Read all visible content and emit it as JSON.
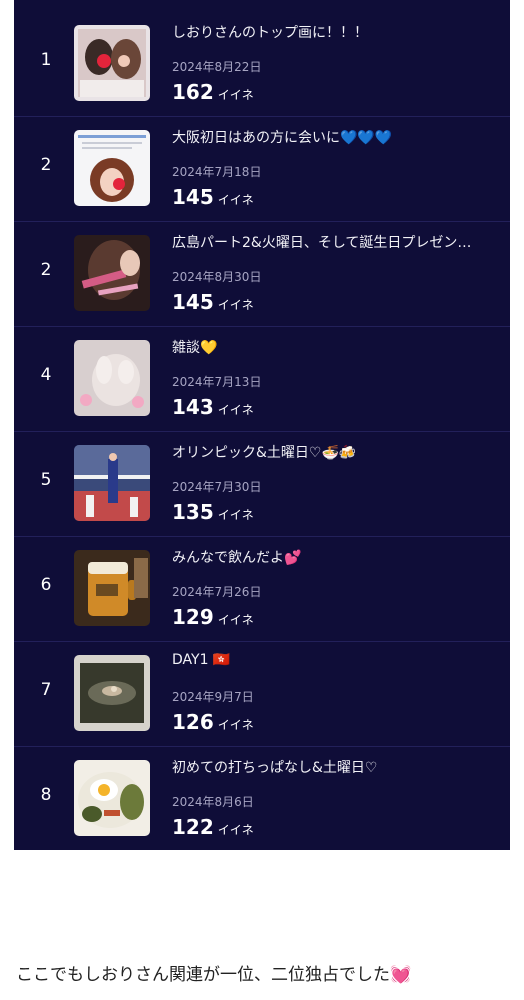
{
  "ranking": {
    "likes_unit": "イイネ",
    "items": [
      {
        "rank": "1",
        "title": "しおりさんのトップ画に！！！",
        "date": "2024年8月22日",
        "likes": "162"
      },
      {
        "rank": "2",
        "title": "大阪初日はあの方に会いに💙💙💙",
        "date": "2024年7月18日",
        "likes": "145"
      },
      {
        "rank": "2",
        "title": "広島パート2&火曜日、そして誕生日プレゼン…",
        "date": "2024年8月30日",
        "likes": "145"
      },
      {
        "rank": "4",
        "title": "雑談💛",
        "date": "2024年7月13日",
        "likes": "143"
      },
      {
        "rank": "5",
        "title": "オリンピック&土曜日♡🍜🍻",
        "date": "2024年7月30日",
        "likes": "135"
      },
      {
        "rank": "6",
        "title": "みんなで飲んだよ💕",
        "date": "2024年7月26日",
        "likes": "129"
      },
      {
        "rank": "7",
        "title": "DAY1 🇭🇰",
        "date": "2024年9月7日",
        "likes": "126"
      },
      {
        "rank": "8",
        "title": "初めての打ちっぱなし&土曜日♡",
        "date": "2024年8月6日",
        "likes": "122"
      }
    ]
  },
  "caption": {
    "text": "ここでもしおりさん関連が一位、二位独占でした",
    "emoji": "💓"
  }
}
